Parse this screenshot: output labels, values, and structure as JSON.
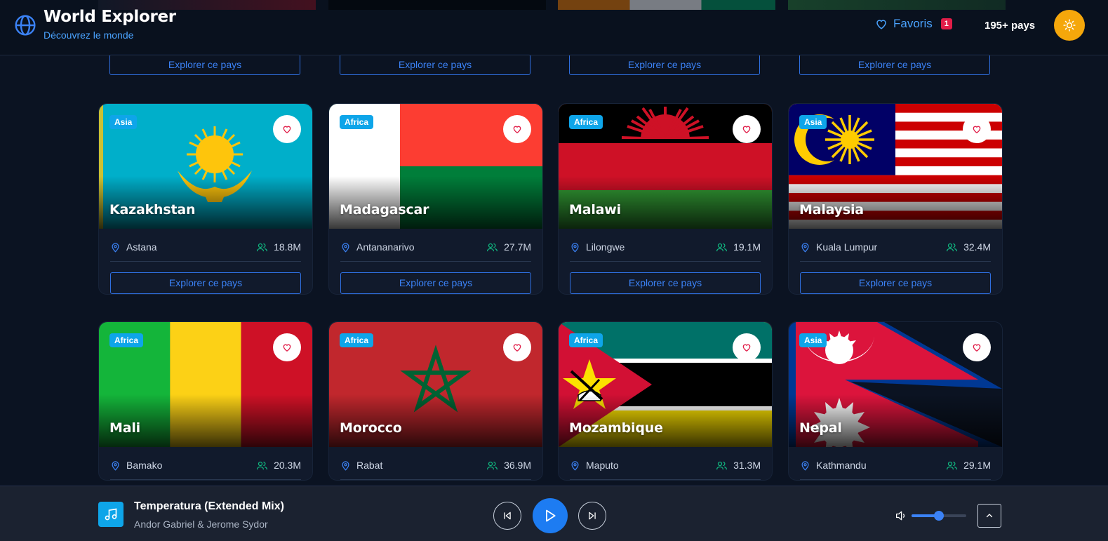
{
  "header": {
    "title": "World Explorer",
    "subtitle": "Découvrez le monde",
    "favorites_label": "Favoris",
    "favorites_count": "1",
    "country_count": "195+ pays"
  },
  "explore_label": "Explorer ce pays",
  "countries": [
    {
      "name": "Kazakhstan",
      "continent": "Asia",
      "capital": "Astana",
      "population": "18.8M"
    },
    {
      "name": "Madagascar",
      "continent": "Africa",
      "capital": "Antananarivo",
      "population": "27.7M"
    },
    {
      "name": "Malawi",
      "continent": "Africa",
      "capital": "Lilongwe",
      "population": "19.1M"
    },
    {
      "name": "Malaysia",
      "continent": "Asia",
      "capital": "Kuala Lumpur",
      "population": "32.4M"
    },
    {
      "name": "Mali",
      "continent": "Africa",
      "capital": "Bamako",
      "population": "20.3M"
    },
    {
      "name": "Morocco",
      "continent": "Africa",
      "capital": "Rabat",
      "population": "36.9M"
    },
    {
      "name": "Mozambique",
      "continent": "Africa",
      "capital": "Maputo",
      "population": "31.3M"
    },
    {
      "name": "Nepal",
      "continent": "Asia",
      "capital": "Kathmandu",
      "population": "29.1M"
    }
  ],
  "player": {
    "track_title": "Temperatura (Extended Mix)",
    "artist": "Andor Gabriel & Jerome Sydor",
    "volume": 0.5
  },
  "colors": {
    "accent": "#3b82f6",
    "continent_badge": "#0ea5e9",
    "theme_button": "#f5a70b",
    "background": "#0b1322"
  }
}
